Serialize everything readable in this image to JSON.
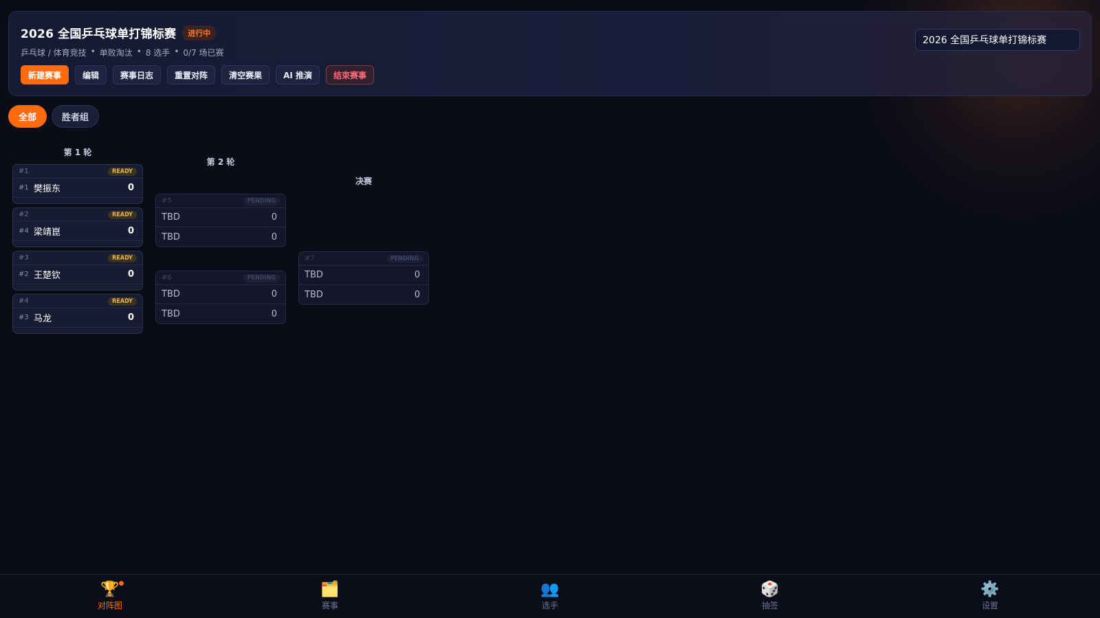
{
  "header": {
    "title": "2026 全国乒乓球单打锦标赛",
    "status": "进行中",
    "meta": [
      "乒乓球 / 体育竞技",
      "单败淘汰",
      "8 选手",
      "0/7 场已赛"
    ],
    "meta_separator": "•",
    "actions": {
      "new": "新建赛事",
      "edit": "编辑",
      "log": "赛事日志",
      "reset": "重置对阵",
      "clear": "清空赛果",
      "ai": "AI 推演",
      "end": "结束赛事"
    },
    "search_value": "2026 全国乒乓球单打锦标赛"
  },
  "filters": {
    "all": "全部",
    "winners": "胜者组"
  },
  "bracket": {
    "rounds": [
      "第 1 轮",
      "第 2 轮",
      "决赛"
    ],
    "round1": [
      {
        "id": "#1",
        "tag": "READY",
        "seed": "#1",
        "player": "樊振东",
        "score": "0"
      },
      {
        "id": "#2",
        "tag": "READY",
        "seed": "#4",
        "player": "梁靖崑",
        "score": "0"
      },
      {
        "id": "#3",
        "tag": "READY",
        "seed": "#2",
        "player": "王楚钦",
        "score": "0"
      },
      {
        "id": "#4",
        "tag": "READY",
        "seed": "#3",
        "player": "马龙",
        "score": "0"
      }
    ],
    "round2": [
      {
        "id": "#5",
        "tag": "PENDING",
        "p1": "TBD",
        "s1": "0",
        "p2": "TBD",
        "s2": "0"
      },
      {
        "id": "#6",
        "tag": "PENDING",
        "p1": "TBD",
        "s1": "0",
        "p2": "TBD",
        "s2": "0"
      }
    ],
    "final": {
      "id": "#7",
      "tag": "PENDING",
      "p1": "TBD",
      "s1": "0",
      "p2": "TBD",
      "s2": "0"
    }
  },
  "nav": [
    {
      "label": "对阵图",
      "icon": "trophy-icon",
      "glyph": "🏆"
    },
    {
      "label": "赛事",
      "icon": "folder-icon",
      "glyph": "🗂️"
    },
    {
      "label": "选手",
      "icon": "people-icon",
      "glyph": "👥"
    },
    {
      "label": "抽签",
      "icon": "dice-icon",
      "glyph": "🎲"
    },
    {
      "label": "设置",
      "icon": "gear-icon",
      "glyph": "⚙️"
    }
  ],
  "colors": {
    "accent": "#ff6a0c",
    "ready": "#e8b04a",
    "danger": "#ff6a7a"
  }
}
